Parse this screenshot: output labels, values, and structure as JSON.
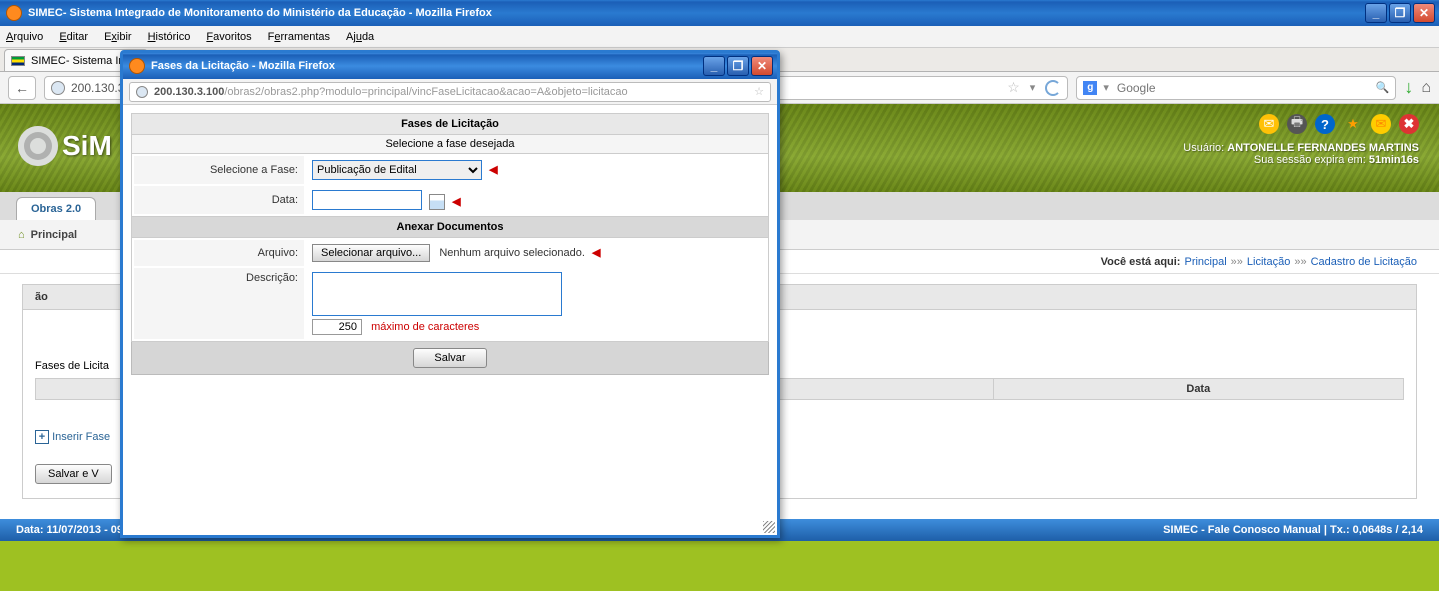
{
  "main_window": {
    "title": "SIMEC- Sistema Integrado de Monitoramento do Ministério da Educação - Mozilla Firefox",
    "min": "_",
    "max": "❐",
    "close": "✕"
  },
  "menubar": {
    "arquivo": "Arquivo",
    "editar": "Editar",
    "exibir": "Exibir",
    "historico": "Histórico",
    "favoritos": "Favoritos",
    "ferramentas": "Ferramentas",
    "ajuda": "Ajuda"
  },
  "tab": {
    "label": "SIMEC- Sistema Int..."
  },
  "url": {
    "main": "200.130.3.1...",
    "search_placeholder": "Google",
    "search_engine_letter": "g"
  },
  "simec": {
    "logo_text": "SiM",
    "user_label": "Usuário:",
    "user_name": "ANTONELLE FERNANDES MARTINS",
    "session_label": "Sua sessão expira em:",
    "session_time": "51min16s"
  },
  "apptab": {
    "label": "Obras 2.0"
  },
  "subtab": {
    "label": "Principal"
  },
  "breadcrumb": {
    "label": "Você está aqui:",
    "p1": "Principal",
    "sep1": "»»",
    "p2": "Licitação",
    "sep2": "»»",
    "p3": "Cadastro de Licitação"
  },
  "work": {
    "band_suffix": "ão",
    "fases_label": "Fases de Licita",
    "add_link": "Inserir Fase",
    "save_btn": "Salvar e V",
    "col_data": "Data"
  },
  "footer": {
    "left": "Data: 11/07/2013 - 09:1",
    "right": "SIMEC - Fale Conosco Manual    | Tx.: 0,0648s / 2,14"
  },
  "popup": {
    "title": "Fases da Licitação - Mozilla Firefox",
    "min": "_",
    "max": "❐",
    "close": "✕",
    "url_visible": "200.130.3.100",
    "url_rest": "/obras2/obras2.php?modulo=principal/vincFaseLicitacao&acao=A&objeto=licitacao",
    "sec_title": "Fases de Licitação",
    "sec_sub": "Selecione a fase desejada",
    "lbl_fase": "Selecione a Fase:",
    "opt_fase": "Publicação de Edital",
    "lbl_data": "Data:",
    "anexar_title": "Anexar Documentos",
    "lbl_arquivo": "Arquivo:",
    "btn_file": "Selecionar arquivo...",
    "no_file": "Nenhum arquivo selecionado.",
    "lbl_desc": "Descrição:",
    "counter": "250",
    "maxchar": "máximo de caracteres",
    "btn_salvar": "Salvar"
  }
}
